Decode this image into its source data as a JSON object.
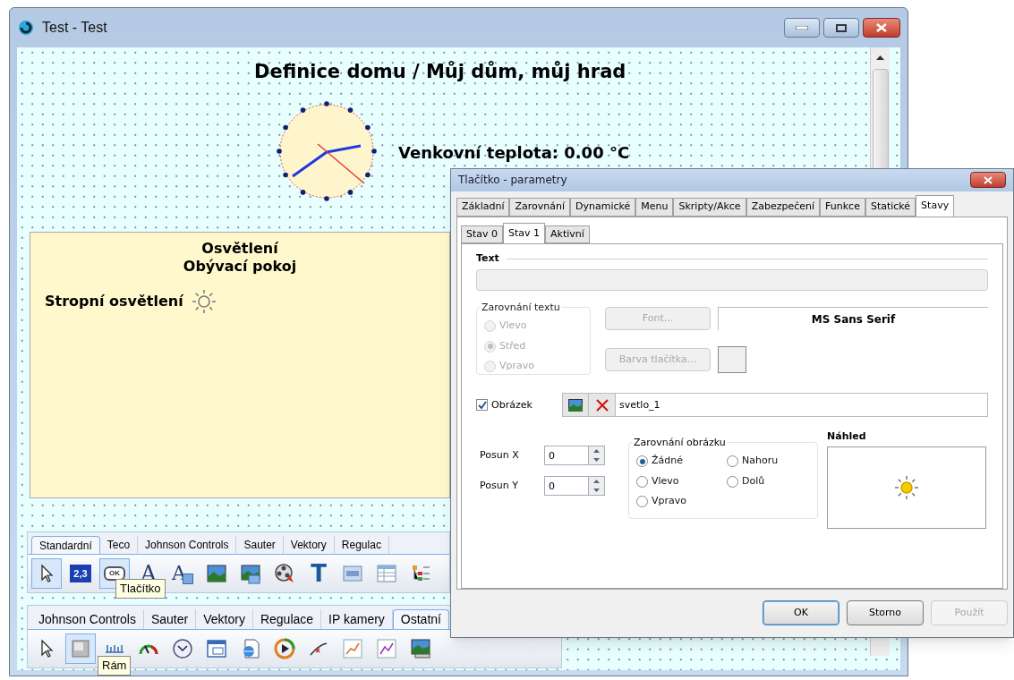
{
  "main_window": {
    "title": "Test - Test",
    "heading": "Definice domu / Můj dům, můj hrad",
    "temperature": "Venkovní teplota: 0.00 °C",
    "panel": {
      "title": "Osvětlení",
      "subtitle": "Obývací pokoj",
      "item_label": "Stropní osvětlení"
    }
  },
  "toolbox_1": {
    "tabs": [
      {
        "label": "Standardní",
        "selected": true
      },
      {
        "label": "Teco",
        "selected": false
      },
      {
        "label": "Johnson Controls",
        "selected": false
      },
      {
        "label": "Sauter",
        "selected": false
      },
      {
        "label": "Vektory",
        "selected": false
      },
      {
        "label": "Regulac",
        "selected": false
      }
    ],
    "tools": [
      {
        "kind": "pointer",
        "selected": true
      },
      {
        "kind": "number",
        "label": "2,3",
        "selected": false
      },
      {
        "kind": "button",
        "label": "OK",
        "selected": true
      },
      {
        "kind": "letter",
        "label": "A",
        "selected": false
      },
      {
        "kind": "letter-chart",
        "label": "A",
        "selected": false
      },
      {
        "kind": "picture",
        "selected": false
      },
      {
        "kind": "picture-chart",
        "selected": false
      },
      {
        "kind": "film",
        "selected": false
      },
      {
        "kind": "bold-letter",
        "label": "T",
        "selected": false
      },
      {
        "kind": "panel",
        "selected": false
      },
      {
        "kind": "table",
        "selected": false
      },
      {
        "kind": "tree",
        "selected": false
      }
    ],
    "tooltip": "Tlačítko"
  },
  "toolbox_2": {
    "tabs": [
      {
        "label": "Johnson Controls",
        "selected": false
      },
      {
        "label": "Sauter",
        "selected": false
      },
      {
        "label": "Vektory",
        "selected": false
      },
      {
        "label": "Regulace",
        "selected": false
      },
      {
        "label": "IP kamery",
        "selected": false
      },
      {
        "label": "Ostatní",
        "selected": true
      }
    ],
    "tools": [
      {
        "kind": "pointer",
        "selected": false
      },
      {
        "kind": "frame",
        "selected": true
      },
      {
        "kind": "ruler",
        "selected": false
      },
      {
        "kind": "gauge",
        "selected": false
      },
      {
        "kind": "clock",
        "selected": false
      },
      {
        "kind": "window",
        "selected": false
      },
      {
        "kind": "globe-page",
        "selected": false
      },
      {
        "kind": "play",
        "selected": false
      },
      {
        "kind": "curve",
        "selected": false
      },
      {
        "kind": "chart",
        "selected": false
      },
      {
        "kind": "chart-purple",
        "selected": false
      },
      {
        "kind": "picture-monitor",
        "selected": false
      }
    ],
    "tooltip": "Rám"
  },
  "dialog": {
    "title": "Tlačítko - parametry",
    "tabs": [
      {
        "label": "Základní",
        "selected": false
      },
      {
        "label": "Zarovnání",
        "selected": false
      },
      {
        "label": "Dynamické",
        "selected": false
      },
      {
        "label": "Menu",
        "selected": false
      },
      {
        "label": "Skripty/Akce",
        "selected": false
      },
      {
        "label": "Zabezpečení",
        "selected": false
      },
      {
        "label": "Funkce",
        "selected": false
      },
      {
        "label": "Statické",
        "selected": false
      },
      {
        "label": "Stavy",
        "selected": true
      }
    ],
    "subtabs": [
      {
        "label": "Stav 0",
        "selected": false
      },
      {
        "label": "Stav 1",
        "selected": true
      },
      {
        "label": "Aktivní",
        "selected": false
      }
    ],
    "text_section": "Text",
    "text_alignment": {
      "title": "Zarovnání textu",
      "disabled": true,
      "options": [
        {
          "label": "Vlevo",
          "selected": false
        },
        {
          "label": "Střed",
          "selected": true
        },
        {
          "label": "Vpravo",
          "selected": false
        }
      ]
    },
    "font_button": {
      "label": "Font...",
      "disabled": true
    },
    "font_name": "MS Sans Serif",
    "color_button": {
      "label": "Barva tlačítka...",
      "disabled": true
    },
    "image": {
      "label": "Obrázek",
      "checked": true,
      "value": "svetlo_1"
    },
    "offset_x": {
      "label": "Posun X",
      "value": "0"
    },
    "offset_y": {
      "label": "Posun Y",
      "value": "0"
    },
    "image_alignment": {
      "title": "Zarovnání obrázku",
      "options": [
        {
          "label": "Žádné",
          "selected": true
        },
        {
          "label": "Nahoru",
          "selected": false
        },
        {
          "label": "Vlevo",
          "selected": false
        },
        {
          "label": "Dolů",
          "selected": false
        },
        {
          "label": "Vpravo",
          "selected": false
        }
      ]
    },
    "preview_label": "Náhled",
    "buttons": [
      {
        "label": "OK",
        "kind": "default",
        "disabled": false
      },
      {
        "label": "Storno",
        "kind": "normal",
        "disabled": false
      },
      {
        "label": "Použít",
        "kind": "normal",
        "disabled": true
      }
    ]
  }
}
